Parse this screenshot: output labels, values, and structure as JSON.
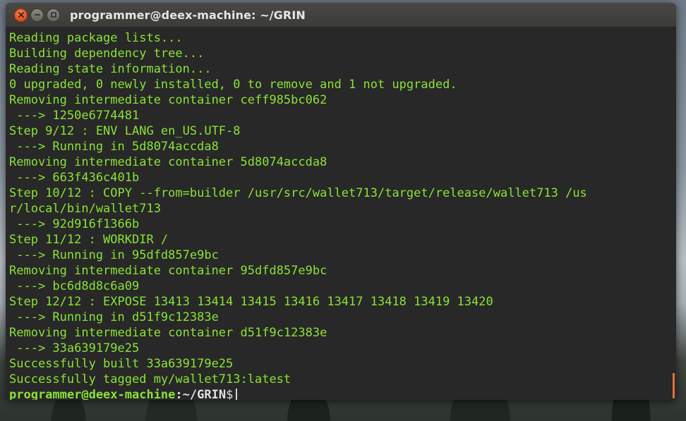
{
  "window": {
    "title": "programmer@deex-machine: ~/GRIN",
    "buttons": {
      "close_icon": "close-icon",
      "minimize_icon": "minimize-icon",
      "maximize_icon": "maximize-icon"
    }
  },
  "terminal": {
    "lines": [
      "Reading package lists...",
      "Building dependency tree...",
      "Reading state information...",
      "0 upgraded, 0 newly installed, 0 to remove and 1 not upgraded.",
      "Removing intermediate container ceff985bc062",
      " ---> 1250e6774481",
      "Step 9/12 : ENV LANG en_US.UTF-8",
      " ---> Running in 5d8074accda8",
      "Removing intermediate container 5d8074accda8",
      " ---> 663f436c401b",
      "Step 10/12 : COPY --from=builder /usr/src/wallet713/target/release/wallet713 /us",
      "r/local/bin/wallet713",
      " ---> 92d916f1366b",
      "Step 11/12 : WORKDIR /",
      " ---> Running in 95dfd857e9bc",
      "Removing intermediate container 95dfd857e9bc",
      " ---> bc6d8d8c6a09",
      "Step 12/12 : EXPOSE 13413 13414 13415 13416 13417 13418 13419 13420",
      " ---> Running in d51f9c12383e",
      "Removing intermediate container d51f9c12383e",
      " ---> 33a639179e25",
      "Successfully built 33a639179e25",
      "Successfully tagged my/wallet713:latest"
    ],
    "prompt": {
      "user_host": "programmer@deex-machine",
      "separator": ":",
      "path": "~/GRIN",
      "symbol": "$"
    }
  },
  "colors": {
    "text_green": "#8ae234",
    "terminal_bg": "#282828",
    "titlebar": "#3c3b37",
    "close_orange": "#e2531f",
    "scroll_accent": "#e4713a"
  }
}
